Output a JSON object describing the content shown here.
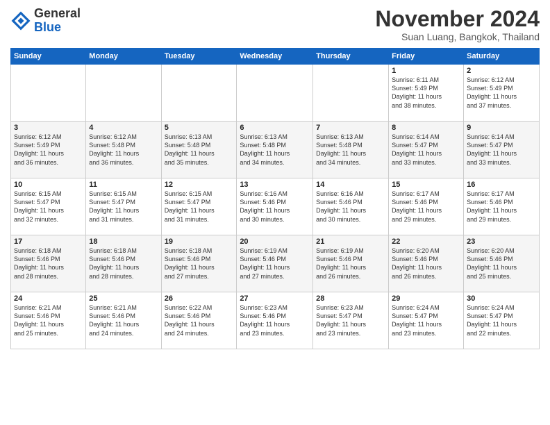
{
  "logo": {
    "general": "General",
    "blue": "Blue"
  },
  "title": "November 2024",
  "location": "Suan Luang, Bangkok, Thailand",
  "weekdays": [
    "Sunday",
    "Monday",
    "Tuesday",
    "Wednesday",
    "Thursday",
    "Friday",
    "Saturday"
  ],
  "weeks": [
    [
      {
        "day": "",
        "info": ""
      },
      {
        "day": "",
        "info": ""
      },
      {
        "day": "",
        "info": ""
      },
      {
        "day": "",
        "info": ""
      },
      {
        "day": "",
        "info": ""
      },
      {
        "day": "1",
        "info": "Sunrise: 6:11 AM\nSunset: 5:49 PM\nDaylight: 11 hours\nand 38 minutes."
      },
      {
        "day": "2",
        "info": "Sunrise: 6:12 AM\nSunset: 5:49 PM\nDaylight: 11 hours\nand 37 minutes."
      }
    ],
    [
      {
        "day": "3",
        "info": "Sunrise: 6:12 AM\nSunset: 5:49 PM\nDaylight: 11 hours\nand 36 minutes."
      },
      {
        "day": "4",
        "info": "Sunrise: 6:12 AM\nSunset: 5:48 PM\nDaylight: 11 hours\nand 36 minutes."
      },
      {
        "day": "5",
        "info": "Sunrise: 6:13 AM\nSunset: 5:48 PM\nDaylight: 11 hours\nand 35 minutes."
      },
      {
        "day": "6",
        "info": "Sunrise: 6:13 AM\nSunset: 5:48 PM\nDaylight: 11 hours\nand 34 minutes."
      },
      {
        "day": "7",
        "info": "Sunrise: 6:13 AM\nSunset: 5:48 PM\nDaylight: 11 hours\nand 34 minutes."
      },
      {
        "day": "8",
        "info": "Sunrise: 6:14 AM\nSunset: 5:47 PM\nDaylight: 11 hours\nand 33 minutes."
      },
      {
        "day": "9",
        "info": "Sunrise: 6:14 AM\nSunset: 5:47 PM\nDaylight: 11 hours\nand 33 minutes."
      }
    ],
    [
      {
        "day": "10",
        "info": "Sunrise: 6:15 AM\nSunset: 5:47 PM\nDaylight: 11 hours\nand 32 minutes."
      },
      {
        "day": "11",
        "info": "Sunrise: 6:15 AM\nSunset: 5:47 PM\nDaylight: 11 hours\nand 31 minutes."
      },
      {
        "day": "12",
        "info": "Sunrise: 6:15 AM\nSunset: 5:47 PM\nDaylight: 11 hours\nand 31 minutes."
      },
      {
        "day": "13",
        "info": "Sunrise: 6:16 AM\nSunset: 5:46 PM\nDaylight: 11 hours\nand 30 minutes."
      },
      {
        "day": "14",
        "info": "Sunrise: 6:16 AM\nSunset: 5:46 PM\nDaylight: 11 hours\nand 30 minutes."
      },
      {
        "day": "15",
        "info": "Sunrise: 6:17 AM\nSunset: 5:46 PM\nDaylight: 11 hours\nand 29 minutes."
      },
      {
        "day": "16",
        "info": "Sunrise: 6:17 AM\nSunset: 5:46 PM\nDaylight: 11 hours\nand 29 minutes."
      }
    ],
    [
      {
        "day": "17",
        "info": "Sunrise: 6:18 AM\nSunset: 5:46 PM\nDaylight: 11 hours\nand 28 minutes."
      },
      {
        "day": "18",
        "info": "Sunrise: 6:18 AM\nSunset: 5:46 PM\nDaylight: 11 hours\nand 28 minutes."
      },
      {
        "day": "19",
        "info": "Sunrise: 6:18 AM\nSunset: 5:46 PM\nDaylight: 11 hours\nand 27 minutes."
      },
      {
        "day": "20",
        "info": "Sunrise: 6:19 AM\nSunset: 5:46 PM\nDaylight: 11 hours\nand 27 minutes."
      },
      {
        "day": "21",
        "info": "Sunrise: 6:19 AM\nSunset: 5:46 PM\nDaylight: 11 hours\nand 26 minutes."
      },
      {
        "day": "22",
        "info": "Sunrise: 6:20 AM\nSunset: 5:46 PM\nDaylight: 11 hours\nand 26 minutes."
      },
      {
        "day": "23",
        "info": "Sunrise: 6:20 AM\nSunset: 5:46 PM\nDaylight: 11 hours\nand 25 minutes."
      }
    ],
    [
      {
        "day": "24",
        "info": "Sunrise: 6:21 AM\nSunset: 5:46 PM\nDaylight: 11 hours\nand 25 minutes."
      },
      {
        "day": "25",
        "info": "Sunrise: 6:21 AM\nSunset: 5:46 PM\nDaylight: 11 hours\nand 24 minutes."
      },
      {
        "day": "26",
        "info": "Sunrise: 6:22 AM\nSunset: 5:46 PM\nDaylight: 11 hours\nand 24 minutes."
      },
      {
        "day": "27",
        "info": "Sunrise: 6:23 AM\nSunset: 5:46 PM\nDaylight: 11 hours\nand 23 minutes."
      },
      {
        "day": "28",
        "info": "Sunrise: 6:23 AM\nSunset: 5:47 PM\nDaylight: 11 hours\nand 23 minutes."
      },
      {
        "day": "29",
        "info": "Sunrise: 6:24 AM\nSunset: 5:47 PM\nDaylight: 11 hours\nand 23 minutes."
      },
      {
        "day": "30",
        "info": "Sunrise: 6:24 AM\nSunset: 5:47 PM\nDaylight: 11 hours\nand 22 minutes."
      }
    ]
  ]
}
